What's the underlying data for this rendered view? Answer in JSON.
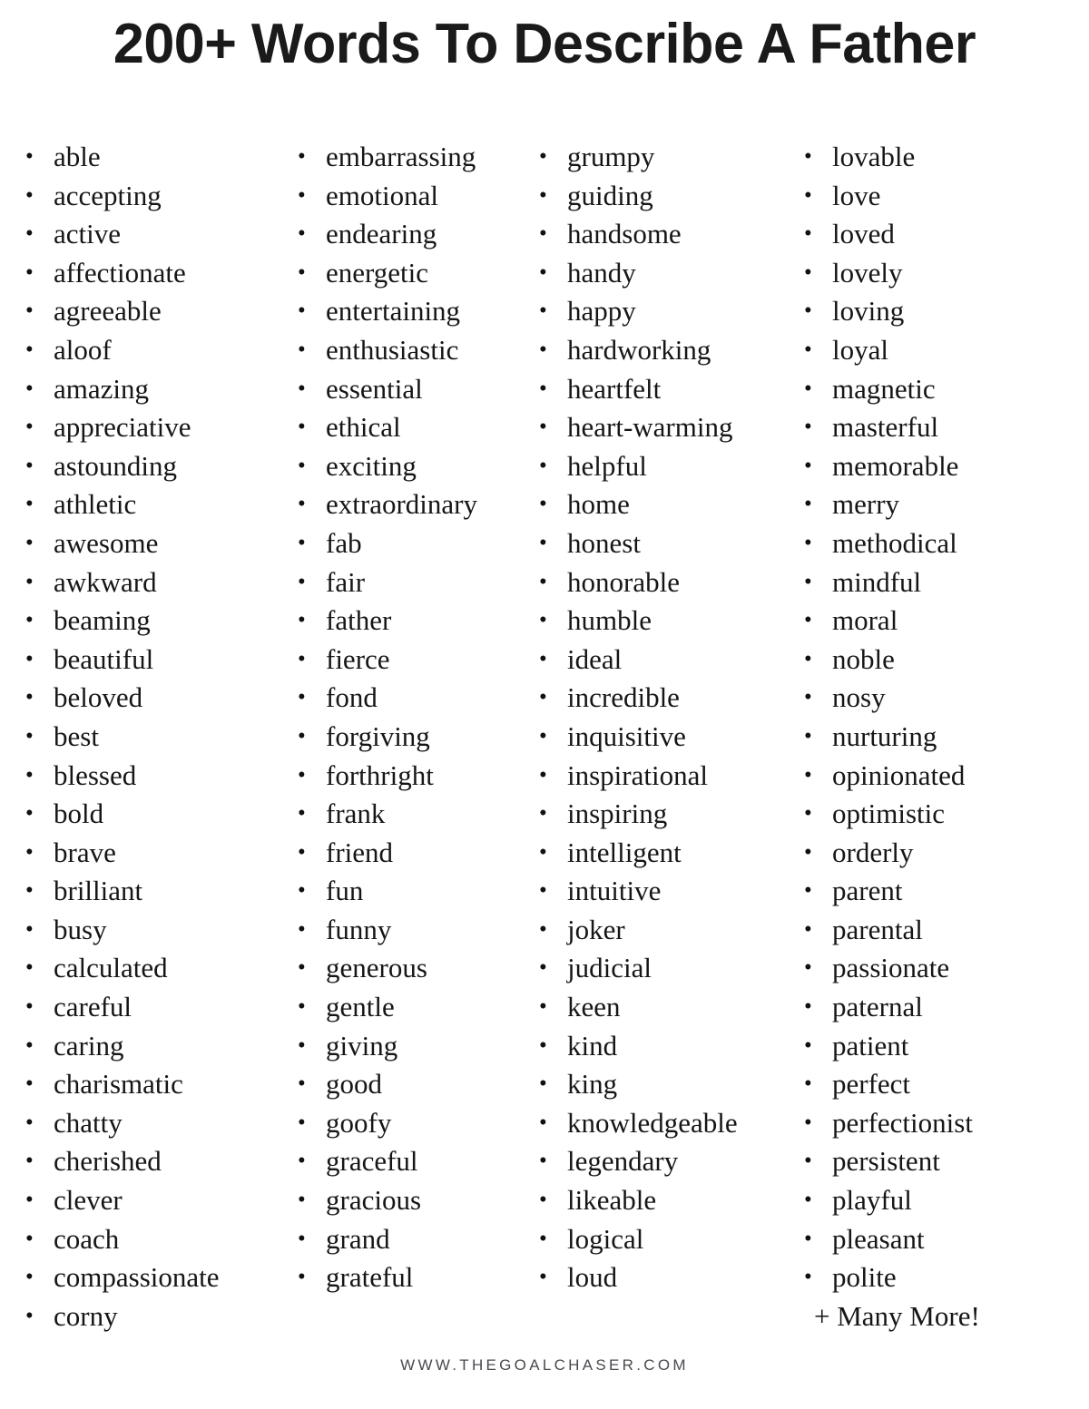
{
  "document": {
    "title": "200+ Words To Describe A Father",
    "background_color": "#ffffff",
    "text_color": "#161616",
    "title_color": "#1a1a1a",
    "footer_color": "#4a4a50"
  },
  "word_columns": [
    {
      "id": "column-1",
      "words": [
        "able",
        "accepting",
        "active",
        "affectionate",
        "agreeable",
        "aloof",
        "amazing",
        "appreciative",
        "astounding",
        "athletic",
        "awesome",
        "awkward",
        "beaming",
        "beautiful",
        "beloved",
        "best",
        "blessed",
        "bold",
        "brave",
        "brilliant",
        "busy",
        "calculated",
        "careful",
        "caring",
        "charismatic",
        "chatty",
        "cherished",
        "clever",
        "coach",
        "compassionate",
        "corny"
      ]
    },
    {
      "id": "column-2",
      "words": [
        "embarrassing",
        "emotional",
        "endearing",
        "energetic",
        "entertaining",
        "enthusiastic",
        "essential",
        "ethical",
        "exciting",
        "extraordinary",
        "fab",
        "fair",
        "father",
        "fierce",
        "fond",
        "forgiving",
        "forthright",
        "frank",
        "friend",
        "fun",
        "funny",
        "generous",
        "gentle",
        "giving",
        "good",
        "goofy",
        "graceful",
        "gracious",
        "grand",
        "grateful"
      ]
    },
    {
      "id": "column-3",
      "words": [
        "grumpy",
        "guiding",
        "handsome",
        "handy",
        "happy",
        "hardworking",
        "heartfelt",
        "heart-warming",
        "helpful",
        "home",
        "honest",
        "honorable",
        "humble",
        "ideal",
        "incredible",
        "inquisitive",
        "inspirational",
        "inspiring",
        "intelligent",
        "intuitive",
        "joker",
        "judicial",
        "keen",
        "kind",
        "king",
        "knowledgeable",
        "legendary",
        "likeable",
        "logical",
        "loud"
      ]
    },
    {
      "id": "column-4",
      "words": [
        "lovable",
        "love",
        "loved",
        "lovely",
        "loving",
        "loyal",
        "magnetic",
        "masterful",
        "memorable",
        "merry",
        "methodical",
        "mindful",
        "moral",
        "noble",
        "nosy",
        "nurturing",
        "opinionated",
        "optimistic",
        "orderly",
        "parent",
        "parental",
        "passionate",
        "paternal",
        "patient",
        "perfect",
        "perfectionist",
        "persistent",
        "playful",
        "pleasant",
        "polite"
      ],
      "trailing_note": "+ Many More!"
    }
  ],
  "footer": {
    "url": "WWW.THEGOALCHASER.COM"
  },
  "bullet_glyph": "•"
}
